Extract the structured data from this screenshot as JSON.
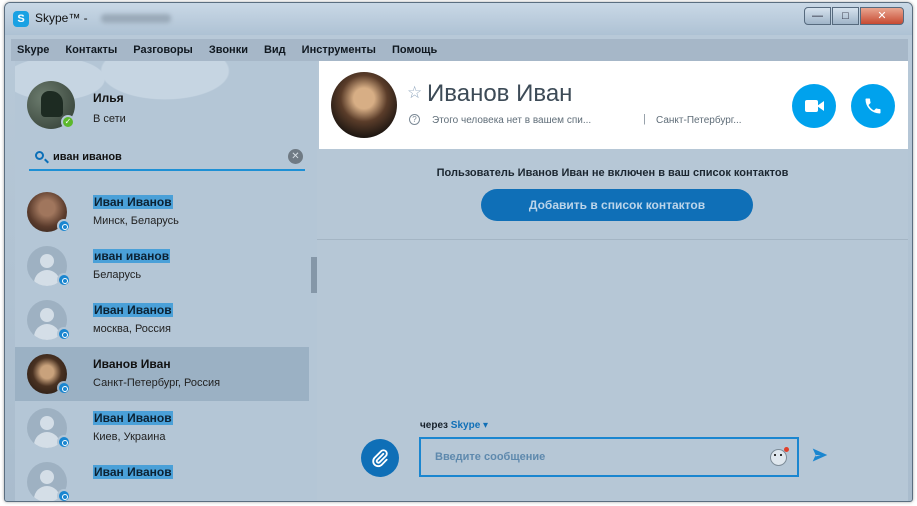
{
  "window": {
    "title": "Skype™ -",
    "controls": {
      "minimize": "—",
      "maximize": "□",
      "close": "✕"
    }
  },
  "menu": [
    "Skype",
    "Контакты",
    "Разговоры",
    "Звонки",
    "Вид",
    "Инструменты",
    "Помощь"
  ],
  "me": {
    "name": "Илья",
    "status": "В сети"
  },
  "search": {
    "value": "иван иванов",
    "icon": "search-icon"
  },
  "contacts": [
    {
      "name": "Иван Иванов",
      "location": "Минск, Беларусь",
      "avatar": "photo"
    },
    {
      "name": "иван иванов",
      "location": "Беларусь",
      "avatar": "default"
    },
    {
      "name": "Иван Иванов",
      "location": "москва, Россия",
      "avatar": "default"
    },
    {
      "name": "Иванов Иван",
      "location": "Санкт-Петербург, Россия",
      "avatar": "photo",
      "selected": true
    },
    {
      "name": "Иван Иванов",
      "location": "Киев, Украина",
      "avatar": "default"
    },
    {
      "name": "Иван Иванов",
      "location": "",
      "avatar": "default"
    }
  ],
  "profile": {
    "name": "Иванов Иван",
    "status": "Этого человека нет в вашем спи...",
    "separator": "|",
    "location": "Санкт-Петербург..."
  },
  "notice": "Пользователь Иванов Иван не включен в ваш список контактов",
  "add_button": "Добавить в список контактов",
  "composer": {
    "via_label": "через",
    "via_service": "Skype ▾",
    "placeholder": "Введите сообщение"
  },
  "colors": {
    "accent": "#00a2ed",
    "button_dark": "#0f6fb7",
    "highlight": "#4aa0d8"
  }
}
